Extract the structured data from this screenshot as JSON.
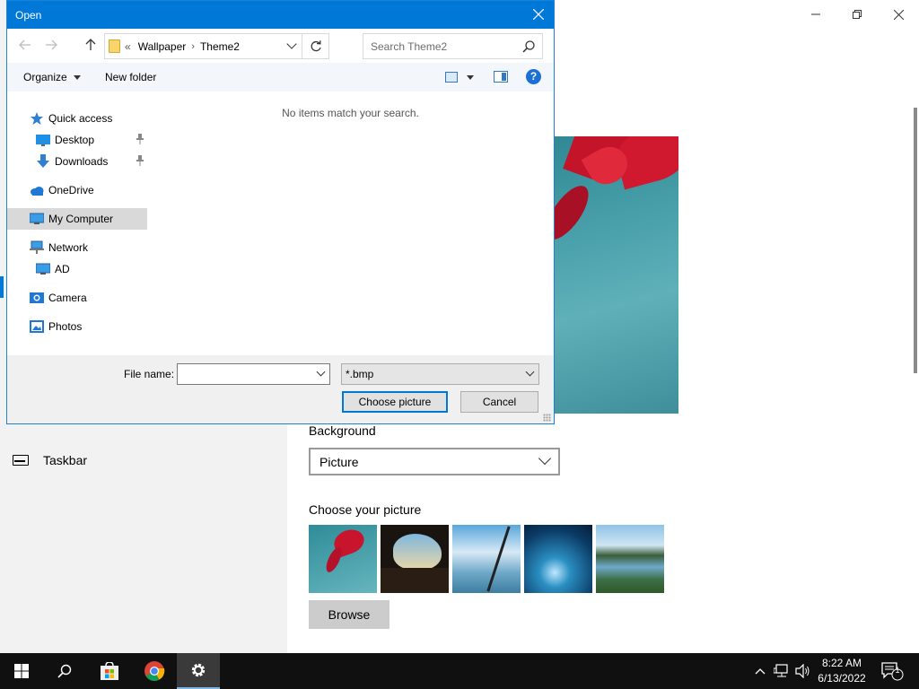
{
  "settings": {
    "nav_item_taskbar": "Taskbar",
    "background_label": "Background",
    "background_value": "Picture",
    "choose_picture_label": "Choose your picture",
    "browse_label": "Browse",
    "accent_color": "#0078d7"
  },
  "dialog": {
    "title": "Open",
    "breadcrumb": {
      "overflow": "«",
      "items": [
        "Wallpaper",
        "Theme2"
      ]
    },
    "search_placeholder": "Search Theme2",
    "organize_label": "Organize",
    "new_folder_label": "New folder",
    "nav_items": [
      {
        "label": "Quick access",
        "icon": "star-icon"
      },
      {
        "label": "Desktop",
        "icon": "desktop-icon",
        "pinned": true
      },
      {
        "label": "Downloads",
        "icon": "download-icon",
        "pinned": true
      },
      {
        "label": "OneDrive",
        "icon": "cloud-icon"
      },
      {
        "label": "My Computer",
        "icon": "computer-icon",
        "selected": true
      },
      {
        "label": "Network",
        "icon": "network-icon"
      },
      {
        "label": "AD",
        "icon": "computer-icon"
      },
      {
        "label": "Camera",
        "icon": "camera-icon"
      },
      {
        "label": "Photos",
        "icon": "photos-icon"
      }
    ],
    "empty_message": "No items match your search.",
    "file_name_label": "File name:",
    "file_name_value": "",
    "file_type_value": "*.bmp",
    "choose_button": "Choose picture",
    "cancel_button": "Cancel"
  },
  "taskbar": {
    "time": "8:22 AM",
    "date": "6/13/2022",
    "notification_count": "1"
  }
}
